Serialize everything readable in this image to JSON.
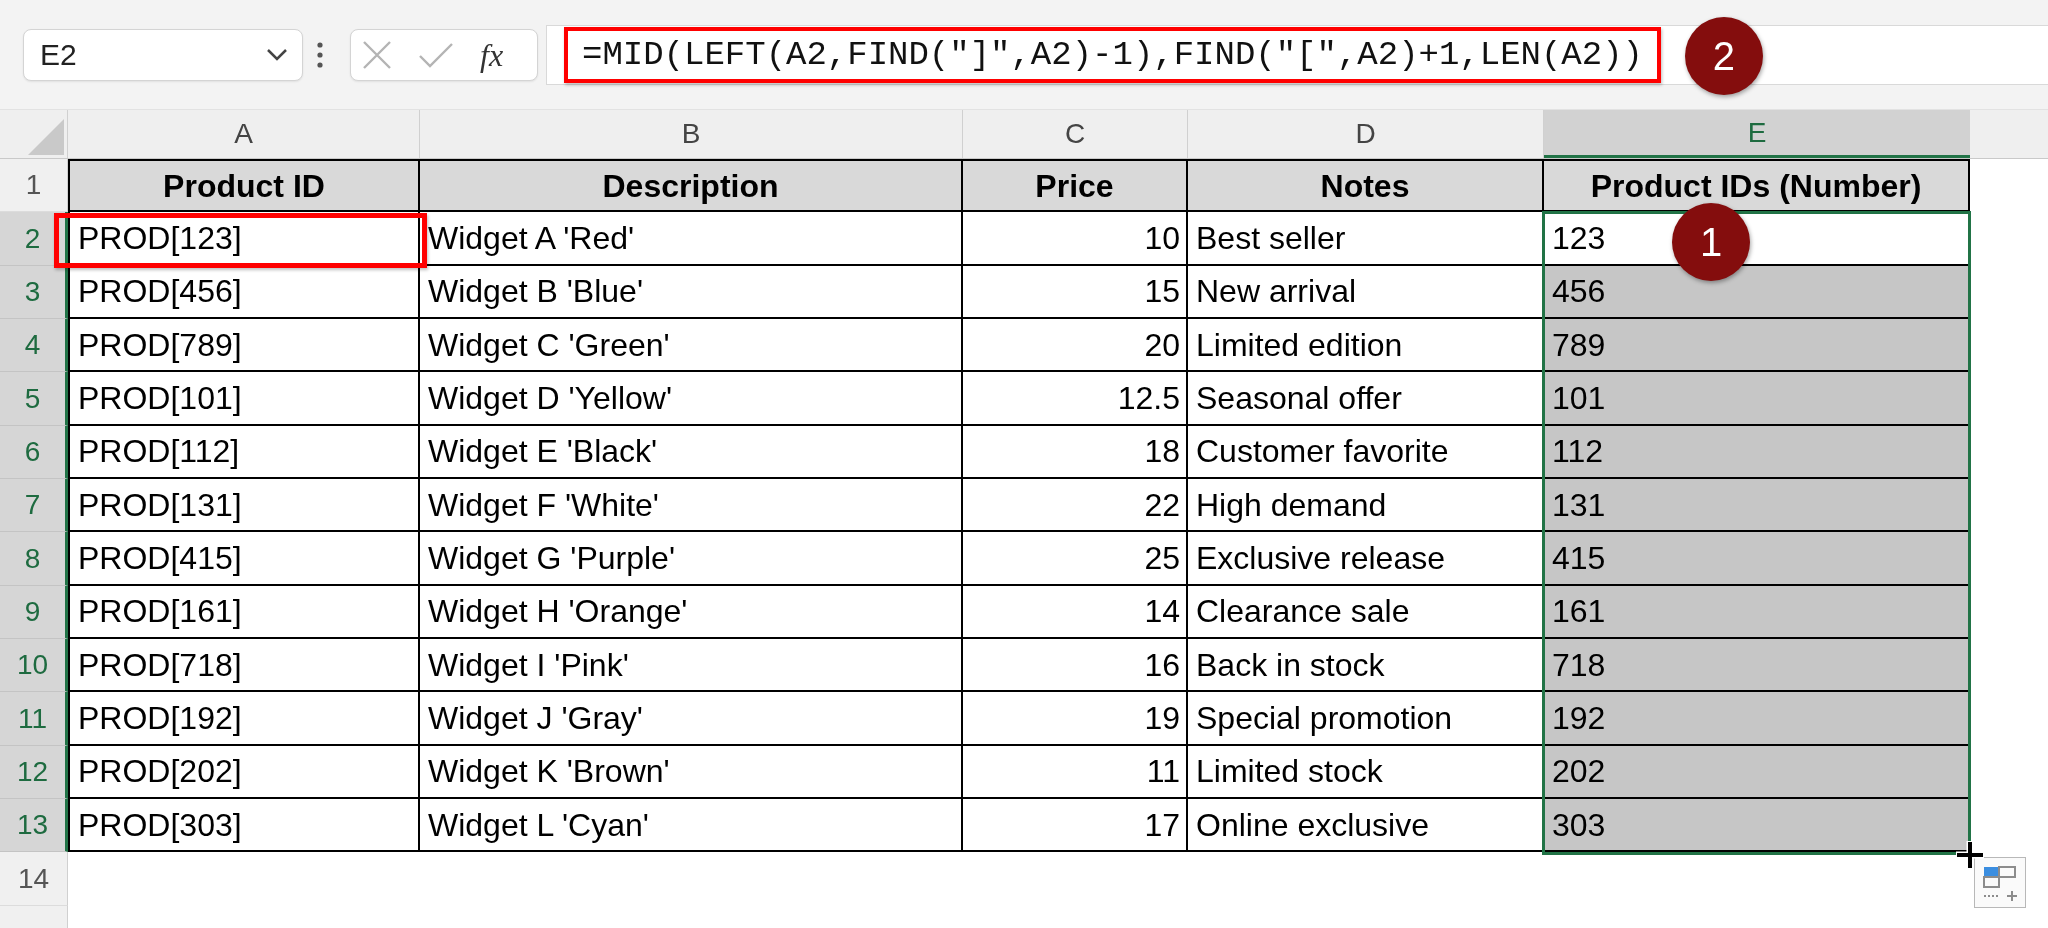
{
  "name_box": {
    "value": "E2"
  },
  "formula_bar": {
    "function_button": "fx",
    "formula": "=MID(LEFT(A2,FIND(\"]\",A2)-1),FIND(\"[\",A2)+1,LEN(A2))",
    "outlined": true,
    "callout": "2"
  },
  "sheet": {
    "columns": [
      {
        "label": "A",
        "selected": false
      },
      {
        "label": "B",
        "selected": false
      },
      {
        "label": "C",
        "selected": false
      },
      {
        "label": "D",
        "selected": false
      },
      {
        "label": "E",
        "selected": true
      }
    ],
    "rows": [
      {
        "number": "1",
        "selected": false,
        "cells": [
          {
            "text": "Product ID",
            "kind": "header",
            "selected": false,
            "active": false,
            "outlined": false
          },
          {
            "text": "Description",
            "kind": "header",
            "selected": false,
            "active": false,
            "outlined": false
          },
          {
            "text": "Price",
            "kind": "header",
            "selected": false,
            "active": false,
            "outlined": false
          },
          {
            "text": "Notes",
            "kind": "header",
            "selected": false,
            "active": false,
            "outlined": false
          },
          {
            "text": "Product IDs (Number)",
            "kind": "header",
            "selected": false,
            "active": false,
            "outlined": false
          }
        ]
      },
      {
        "number": "2",
        "selected": true,
        "cells": [
          {
            "text": "PROD[123]",
            "kind": "text",
            "selected": false,
            "active": false,
            "outlined": true
          },
          {
            "text": "Widget A 'Red'",
            "kind": "text",
            "selected": false,
            "active": false,
            "outlined": false
          },
          {
            "text": "10",
            "kind": "number",
            "selected": false,
            "active": false,
            "outlined": false
          },
          {
            "text": "Best seller",
            "kind": "text",
            "selected": false,
            "active": false,
            "outlined": false
          },
          {
            "text": "123",
            "kind": "text",
            "selected": true,
            "active": true,
            "outlined": false,
            "callout": "1"
          }
        ]
      },
      {
        "number": "3",
        "selected": true,
        "cells": [
          {
            "text": "PROD[456]",
            "kind": "text",
            "selected": false,
            "active": false,
            "outlined": false
          },
          {
            "text": "Widget B 'Blue'",
            "kind": "text",
            "selected": false,
            "active": false,
            "outlined": false
          },
          {
            "text": "15",
            "kind": "number",
            "selected": false,
            "active": false,
            "outlined": false
          },
          {
            "text": "New arrival",
            "kind": "text",
            "selected": false,
            "active": false,
            "outlined": false
          },
          {
            "text": "456",
            "kind": "text",
            "selected": true,
            "active": false,
            "outlined": false
          }
        ]
      },
      {
        "number": "4",
        "selected": true,
        "cells": [
          {
            "text": "PROD[789]",
            "kind": "text",
            "selected": false,
            "active": false,
            "outlined": false
          },
          {
            "text": "Widget C 'Green'",
            "kind": "text",
            "selected": false,
            "active": false,
            "outlined": false
          },
          {
            "text": "20",
            "kind": "number",
            "selected": false,
            "active": false,
            "outlined": false
          },
          {
            "text": "Limited edition",
            "kind": "text",
            "selected": false,
            "active": false,
            "outlined": false
          },
          {
            "text": "789",
            "kind": "text",
            "selected": true,
            "active": false,
            "outlined": false
          }
        ]
      },
      {
        "number": "5",
        "selected": true,
        "cells": [
          {
            "text": "PROD[101]",
            "kind": "text",
            "selected": false,
            "active": false,
            "outlined": false
          },
          {
            "text": "Widget D 'Yellow'",
            "kind": "text",
            "selected": false,
            "active": false,
            "outlined": false
          },
          {
            "text": "12.5",
            "kind": "number",
            "selected": false,
            "active": false,
            "outlined": false
          },
          {
            "text": "Seasonal offer",
            "kind": "text",
            "selected": false,
            "active": false,
            "outlined": false
          },
          {
            "text": "101",
            "kind": "text",
            "selected": true,
            "active": false,
            "outlined": false
          }
        ]
      },
      {
        "number": "6",
        "selected": true,
        "cells": [
          {
            "text": "PROD[112]",
            "kind": "text",
            "selected": false,
            "active": false,
            "outlined": false
          },
          {
            "text": "Widget E 'Black'",
            "kind": "text",
            "selected": false,
            "active": false,
            "outlined": false
          },
          {
            "text": "18",
            "kind": "number",
            "selected": false,
            "active": false,
            "outlined": false
          },
          {
            "text": "Customer favorite",
            "kind": "text",
            "selected": false,
            "active": false,
            "outlined": false
          },
          {
            "text": "112",
            "kind": "text",
            "selected": true,
            "active": false,
            "outlined": false
          }
        ]
      },
      {
        "number": "7",
        "selected": true,
        "cells": [
          {
            "text": "PROD[131]",
            "kind": "text",
            "selected": false,
            "active": false,
            "outlined": false
          },
          {
            "text": "Widget F 'White'",
            "kind": "text",
            "selected": false,
            "active": false,
            "outlined": false
          },
          {
            "text": "22",
            "kind": "number",
            "selected": false,
            "active": false,
            "outlined": false
          },
          {
            "text": "High demand",
            "kind": "text",
            "selected": false,
            "active": false,
            "outlined": false
          },
          {
            "text": "131",
            "kind": "text",
            "selected": true,
            "active": false,
            "outlined": false
          }
        ]
      },
      {
        "number": "8",
        "selected": true,
        "cells": [
          {
            "text": "PROD[415]",
            "kind": "text",
            "selected": false,
            "active": false,
            "outlined": false
          },
          {
            "text": "Widget G 'Purple'",
            "kind": "text",
            "selected": false,
            "active": false,
            "outlined": false
          },
          {
            "text": "25",
            "kind": "number",
            "selected": false,
            "active": false,
            "outlined": false
          },
          {
            "text": "Exclusive release",
            "kind": "text",
            "selected": false,
            "active": false,
            "outlined": false
          },
          {
            "text": "415",
            "kind": "text",
            "selected": true,
            "active": false,
            "outlined": false
          }
        ]
      },
      {
        "number": "9",
        "selected": true,
        "cells": [
          {
            "text": "PROD[161]",
            "kind": "text",
            "selected": false,
            "active": false,
            "outlined": false
          },
          {
            "text": "Widget H 'Orange'",
            "kind": "text",
            "selected": false,
            "active": false,
            "outlined": false
          },
          {
            "text": "14",
            "kind": "number",
            "selected": false,
            "active": false,
            "outlined": false
          },
          {
            "text": "Clearance sale",
            "kind": "text",
            "selected": false,
            "active": false,
            "outlined": false
          },
          {
            "text": "161",
            "kind": "text",
            "selected": true,
            "active": false,
            "outlined": false
          }
        ]
      },
      {
        "number": "10",
        "selected": true,
        "cells": [
          {
            "text": "PROD[718]",
            "kind": "text",
            "selected": false,
            "active": false,
            "outlined": false
          },
          {
            "text": "Widget I 'Pink'",
            "kind": "text",
            "selected": false,
            "active": false,
            "outlined": false
          },
          {
            "text": "16",
            "kind": "number",
            "selected": false,
            "active": false,
            "outlined": false
          },
          {
            "text": "Back in stock",
            "kind": "text",
            "selected": false,
            "active": false,
            "outlined": false
          },
          {
            "text": "718",
            "kind": "text",
            "selected": true,
            "active": false,
            "outlined": false
          }
        ]
      },
      {
        "number": "11",
        "selected": true,
        "cells": [
          {
            "text": "PROD[192]",
            "kind": "text",
            "selected": false,
            "active": false,
            "outlined": false
          },
          {
            "text": "Widget J 'Gray'",
            "kind": "text",
            "selected": false,
            "active": false,
            "outlined": false
          },
          {
            "text": "19",
            "kind": "number",
            "selected": false,
            "active": false,
            "outlined": false
          },
          {
            "text": "Special promotion",
            "kind": "text",
            "selected": false,
            "active": false,
            "outlined": false
          },
          {
            "text": "192",
            "kind": "text",
            "selected": true,
            "active": false,
            "outlined": false
          }
        ]
      },
      {
        "number": "12",
        "selected": true,
        "cells": [
          {
            "text": "PROD[202]",
            "kind": "text",
            "selected": false,
            "active": false,
            "outlined": false
          },
          {
            "text": "Widget K 'Brown'",
            "kind": "text",
            "selected": false,
            "active": false,
            "outlined": false
          },
          {
            "text": "11",
            "kind": "number",
            "selected": false,
            "active": false,
            "outlined": false
          },
          {
            "text": "Limited stock",
            "kind": "text",
            "selected": false,
            "active": false,
            "outlined": false
          },
          {
            "text": "202",
            "kind": "text",
            "selected": true,
            "active": false,
            "outlined": false
          }
        ]
      },
      {
        "number": "13",
        "selected": true,
        "cells": [
          {
            "text": "PROD[303]",
            "kind": "text",
            "selected": false,
            "active": false,
            "outlined": false
          },
          {
            "text": "Widget L 'Cyan'",
            "kind": "text",
            "selected": false,
            "active": false,
            "outlined": false
          },
          {
            "text": "17",
            "kind": "number",
            "selected": false,
            "active": false,
            "outlined": false
          },
          {
            "text": "Online exclusive",
            "kind": "text",
            "selected": false,
            "active": false,
            "outlined": false
          },
          {
            "text": "303",
            "kind": "text",
            "selected": true,
            "active": false,
            "outlined": false
          }
        ]
      },
      {
        "number": "14",
        "selected": false
      }
    ]
  }
}
